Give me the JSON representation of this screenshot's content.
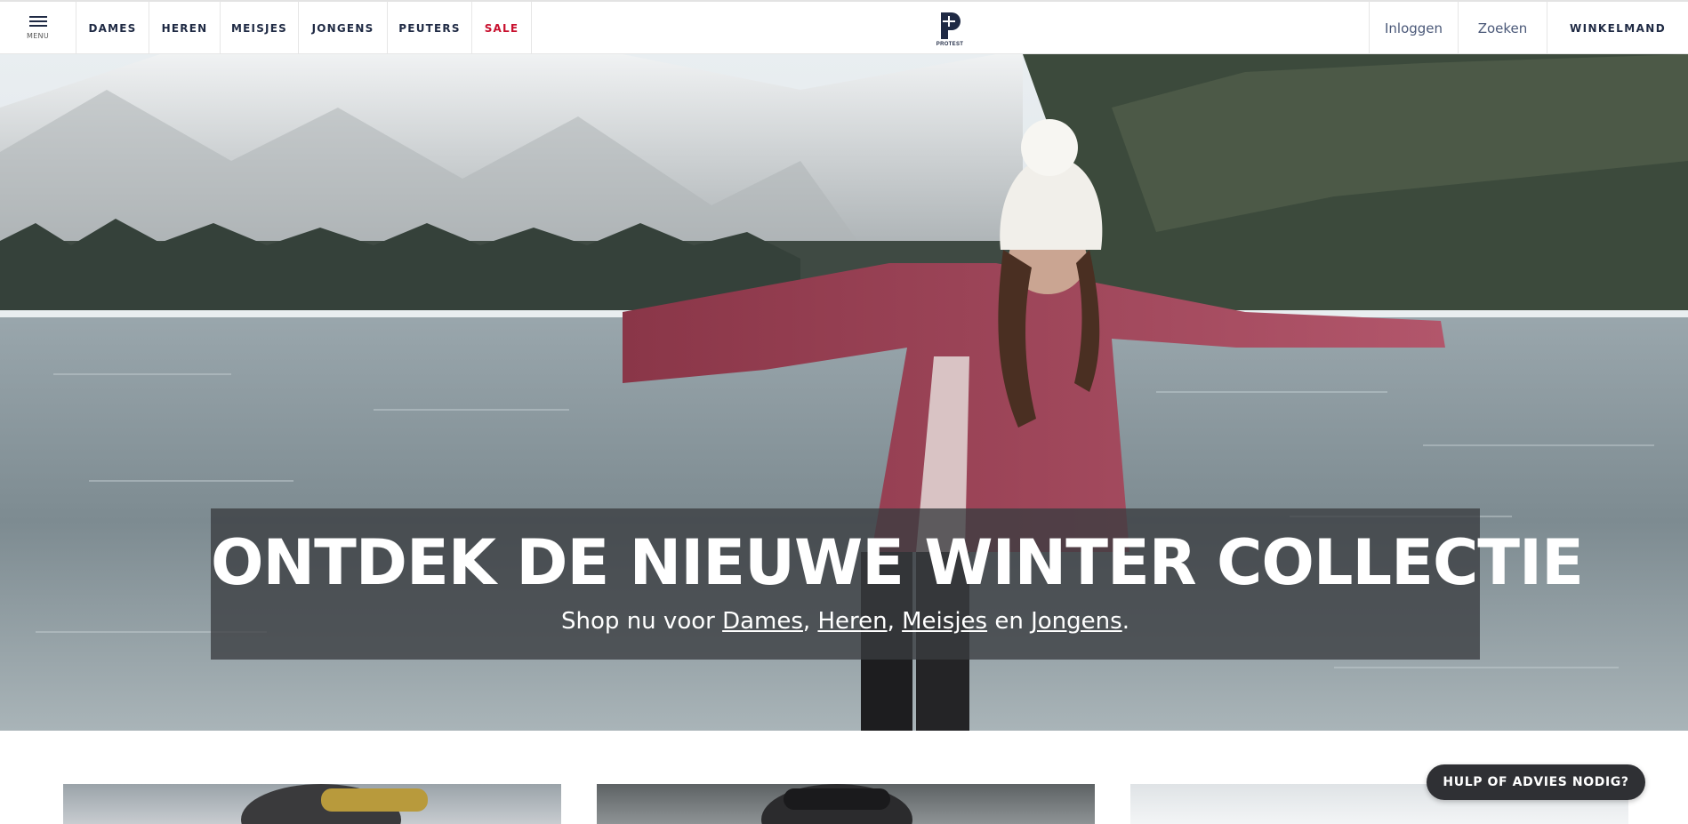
{
  "header": {
    "menu_label": "MENU",
    "nav": [
      "DAMES",
      "HEREN",
      "MEISJES",
      "JONGENS",
      "PEUTERS",
      "SALE"
    ],
    "logo_text": "PROTEST",
    "login": "Inloggen",
    "search": "Zoeken",
    "cart": "WINKELMAND",
    "sale_color": "#c8102e"
  },
  "hero": {
    "title": "ONTDEK DE NIEUWE WINTER COLLECTIE",
    "sub_prefix": "Shop nu voor ",
    "link_dames": "Dames",
    "sep1": ", ",
    "link_heren": "Heren",
    "sep2": ", ",
    "link_meisjes": "Meisjes",
    "sep3": " en ",
    "link_jongens": "Jongens",
    "sub_suffix": "."
  },
  "help_button": "HULP OF ADVIES NODIG?",
  "icons": {
    "menu": "hamburger-icon",
    "logo": "protest-logo"
  }
}
